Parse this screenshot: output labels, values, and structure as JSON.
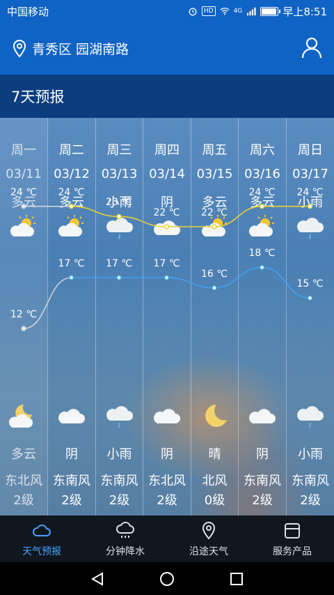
{
  "status_bar": {
    "carrier": "中国移动",
    "network": "4G",
    "time": "早上8:51"
  },
  "location": {
    "text": "青秀区 园湖南路"
  },
  "section": {
    "title": "7天预报"
  },
  "days": [
    {
      "day": "周一",
      "date": "03/11",
      "cond_day": "多云",
      "icon_day": "partly-cloudy-icon",
      "high": "24 ℃",
      "low": "12 ℃",
      "icon_night": "moon-cloud-icon",
      "cond_night": "多云",
      "wind_dir": "东北风",
      "wind_lvl": "2级"
    },
    {
      "day": "周二",
      "date": "03/12",
      "cond_day": "多云",
      "icon_day": "partly-cloudy-icon",
      "high": "24 ℃",
      "low": "17 ℃",
      "icon_night": "cloud-icon",
      "cond_night": "阴",
      "wind_dir": "东南风",
      "wind_lvl": "2级"
    },
    {
      "day": "周三",
      "date": "03/13",
      "cond_day": "小雨",
      "icon_day": "light-rain-icon",
      "high": "23 ℃",
      "low": "17 ℃",
      "icon_night": "light-rain-icon",
      "cond_night": "小雨",
      "wind_dir": "东南风",
      "wind_lvl": "2级"
    },
    {
      "day": "周四",
      "date": "03/14",
      "cond_day": "阴",
      "icon_day": "cloud-icon",
      "high": "22 ℃",
      "low": "17 ℃",
      "icon_night": "cloud-icon",
      "cond_night": "阴",
      "wind_dir": "东北风",
      "wind_lvl": "2级"
    },
    {
      "day": "周五",
      "date": "03/15",
      "cond_day": "多云",
      "icon_day": "partly-cloudy-icon",
      "high": "22 ℃",
      "low": "16 ℃",
      "icon_night": "moon-icon",
      "cond_night": "晴",
      "wind_dir": "北风",
      "wind_lvl": "0级"
    },
    {
      "day": "周六",
      "date": "03/16",
      "cond_day": "多云",
      "icon_day": "partly-cloudy-icon",
      "high": "24 ℃",
      "low": "18 ℃",
      "icon_night": "cloud-icon",
      "cond_night": "阴",
      "wind_dir": "东南风",
      "wind_lvl": "2级"
    },
    {
      "day": "周日",
      "date": "03/17",
      "cond_day": "小雨",
      "icon_day": "light-rain-icon",
      "high": "24 ℃",
      "low": "15 ℃",
      "icon_night": "light-rain-icon",
      "cond_night": "小雨",
      "wind_dir": "东南风",
      "wind_lvl": "2级"
    }
  ],
  "chart_data": {
    "type": "line",
    "x": [
      "周一",
      "周二",
      "周三",
      "周四",
      "周五",
      "周六",
      "周日"
    ],
    "series": [
      {
        "values": [
          24,
          24,
          23,
          22,
          22,
          24,
          24
        ],
        "color": "#e8d230",
        "past_color": "#d0d4da"
      },
      {
        "values": [
          12,
          17,
          17,
          17,
          16,
          18,
          15
        ],
        "color": "#3fa3f0",
        "past_color": "#d0d4da"
      }
    ]
  },
  "nav": [
    {
      "label": "天气预报",
      "icon": "cloud-icon",
      "active": true
    },
    {
      "label": "分钟降水",
      "icon": "rain-cloud-icon",
      "active": false
    },
    {
      "label": "沿途天气",
      "icon": "location-pin-icon",
      "active": false
    },
    {
      "label": "服务产品",
      "icon": "box-icon",
      "active": false
    }
  ],
  "colors": {
    "primary": "#0f63c4",
    "title_bar": "#0b3d7f",
    "accent": "#4aa3ff"
  }
}
